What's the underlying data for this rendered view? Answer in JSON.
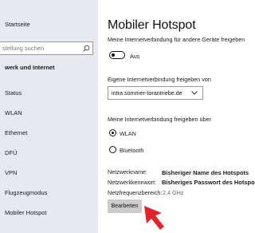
{
  "sidebar": {
    "home_label": "Startseite",
    "search_placeholder": "stellung suchen",
    "section_heading": "werk und Internet",
    "items": [
      {
        "label": "Status"
      },
      {
        "label": "WLAN"
      },
      {
        "label": "Ethernet"
      },
      {
        "label": "DFÜ"
      },
      {
        "label": "VPN"
      },
      {
        "label": "Flugzeugmodus"
      },
      {
        "label": "Mobiler Hotspot"
      }
    ]
  },
  "main": {
    "title": "Mobiler Hotspot",
    "share_description": "Meine Internetverbindung für andere Geräte freigeben",
    "toggle": {
      "state_label": "Aus",
      "on": false
    },
    "share_from": {
      "label": "Eigene Internetverbindung freigeben von",
      "selected": "intra.sommer-torantriebe.de"
    },
    "share_over": {
      "label": "Meine Internetverbindung freigeben über",
      "options": [
        {
          "label": "WLAN",
          "selected": true
        },
        {
          "label": "Bluetooth",
          "selected": false
        }
      ]
    },
    "properties": {
      "network_name_label": "Netzwerkname:",
      "network_name_value": "Bisheriger Name des Hotspots",
      "password_label": "Netzwerkkennwort:",
      "password_value": "Bisheriges Passwort des Hotspots",
      "band_label": "Netzfrequenzbereich:",
      "band_value": "2,4 GHz"
    },
    "edit_button": "Bearbeiten"
  },
  "colors": {
    "sidebar_bg": "#e6e9ef",
    "accent": "#0063b1",
    "cursor_red": "#e0242a",
    "button_bg": "#cccccc"
  }
}
